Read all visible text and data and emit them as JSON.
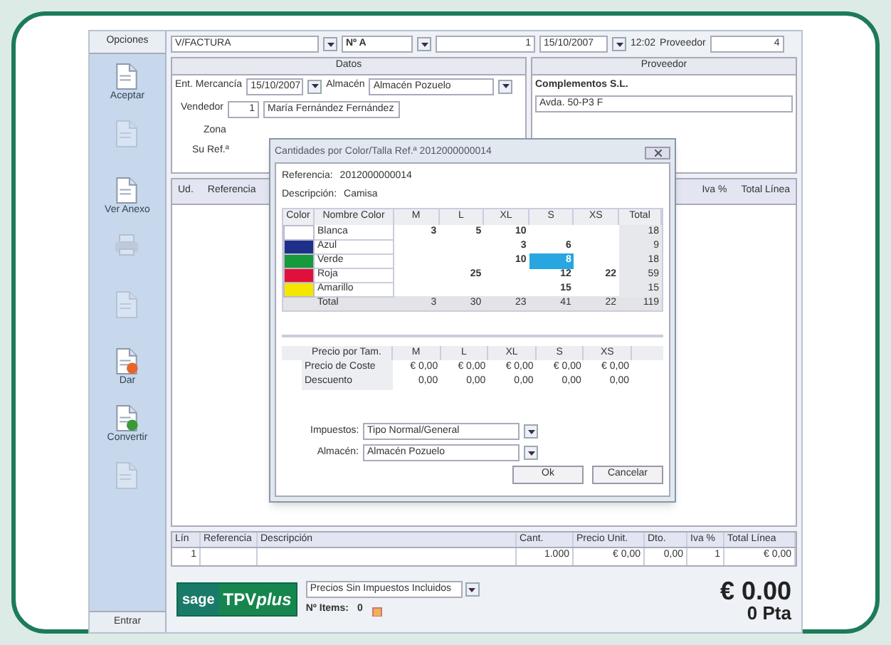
{
  "toolbar": {
    "options_label": "Opciones",
    "document_type": "V/FACTURA",
    "series": "Nº A",
    "number": "1",
    "date": "15/10/2007",
    "time": "12:02",
    "supplier_label": "Proveedor",
    "supplier_code": "4"
  },
  "sidebar": {
    "items": [
      {
        "kind": "doc",
        "label": "Aceptar",
        "disabled": false
      },
      {
        "kind": "doc",
        "disabled": true
      },
      {
        "kind": "doc",
        "label": "Ver Anexo",
        "disabled": false
      },
      {
        "kind": "printer",
        "disabled": true
      },
      {
        "kind": "doc",
        "disabled": true
      },
      {
        "kind": "alert",
        "label": "Dar",
        "disabled": false
      },
      {
        "kind": "convert",
        "label": "Convertir",
        "disabled": false
      },
      {
        "kind": "doc",
        "disabled": true
      }
    ],
    "bottom_button": "Entrar"
  },
  "datos": {
    "title": "Datos",
    "received_label": "Ent. Mercancía",
    "received_date": "15/10/2007",
    "warehouse_label": "Almacén",
    "warehouse": "Almacén Pozuelo",
    "seller_label": "Vendedor",
    "seller_code": "1",
    "seller_name": "María Fernández Fernández",
    "zone_label": "Zona",
    "ref_label": "Su Ref.ª"
  },
  "proveedor": {
    "title": "Proveedor",
    "name": "Complementos S.L.",
    "address": "Avda. 50-P3 F"
  },
  "lines_table": {
    "columns": [
      "Ud.",
      "Referencia",
      "Iva %",
      "Total Línea"
    ]
  },
  "dialog": {
    "title": "Cantidades por Color/Talla Ref.ª 2012000000014",
    "reference_label": "Referencia:",
    "reference": "2012000000014",
    "description_label": "Descripción:",
    "description": "Camisa",
    "grid_columns": [
      "Color",
      "Nombre Color",
      "M",
      "L",
      "XL",
      "S",
      "XS",
      "Total"
    ],
    "grid_rows": [
      {
        "name": "Blanca",
        "color": "#ffffff",
        "total": "18",
        "cells": [
          {
            "value": "3",
            "selected": false
          },
          {
            "value": "5",
            "selected": false
          },
          {
            "value": "10",
            "selected": false
          },
          {
            "selected": false
          },
          {
            "selected": false
          }
        ]
      },
      {
        "name": "Azul",
        "color": "#1e2f8a",
        "total": "9",
        "cells": [
          {
            "selected": false
          },
          {
            "selected": false
          },
          {
            "value": "3",
            "selected": false
          },
          {
            "value": "6",
            "selected": false
          },
          {
            "selected": false
          }
        ]
      },
      {
        "name": "Verde",
        "color": "#169a3c",
        "total": "18",
        "cells": [
          {
            "selected": false
          },
          {
            "selected": false
          },
          {
            "value": "10",
            "selected": false
          },
          {
            "value": "8",
            "selected": true
          },
          {
            "selected": false
          }
        ]
      },
      {
        "name": "Roja",
        "color": "#e0103c",
        "total": "59",
        "cells": [
          {
            "selected": false
          },
          {
            "value": "25",
            "selected": false
          },
          {
            "selected": false
          },
          {
            "value": "12",
            "selected": false
          },
          {
            "value": "22",
            "selected": false
          }
        ]
      },
      {
        "name": "Amarillo",
        "color": "#f5e600",
        "total": "15",
        "cells": [
          {
            "selected": false
          },
          {
            "selected": false
          },
          {
            "selected": false
          },
          {
            "value": "15",
            "selected": false
          },
          {
            "selected": false
          }
        ]
      }
    ],
    "grid_total": {
      "label": "Total",
      "values": [
        "3",
        "30",
        "23",
        "41",
        "22",
        "119"
      ]
    },
    "price_columns": [
      "Precio por Tam.",
      "M",
      "L",
      "XL",
      "S",
      "XS"
    ],
    "price_rows": [
      {
        "label": "Precio de Coste",
        "values": [
          "€ 0,00",
          "€ 0,00",
          "€ 0,00",
          "€ 0,00",
          "€ 0,00"
        ]
      },
      {
        "label": "Descuento",
        "values": [
          "0,00",
          "0,00",
          "0,00",
          "0,00",
          "0,00"
        ]
      }
    ],
    "tax_label": "Impuestos:",
    "tax": "Tipo Normal/General",
    "warehouse_label": "Almacén:",
    "warehouse": "Almacén Pozuelo",
    "ok": "Ok",
    "cancel": "Cancelar"
  },
  "footer_table": {
    "columns": [
      "Lín",
      "Referencia",
      "Descripción",
      "Cant.",
      "Precio Unit.",
      "Dto.",
      "Iva %",
      "Total Línea"
    ],
    "rows": [
      [
        "1",
        "",
        "",
        "1.000",
        "€ 0,00",
        "0,00",
        "1",
        "€ 0,00"
      ]
    ]
  },
  "footer": {
    "logo_left": "sage",
    "logo_right": "TPV",
    "logo_suffix": "plus",
    "price_mode": "Precios Sin Impuestos Incluidos",
    "items_label": "Nº Items:",
    "items": "0",
    "total_euro": "€ 0.00",
    "total_pta": "0 Pta"
  }
}
